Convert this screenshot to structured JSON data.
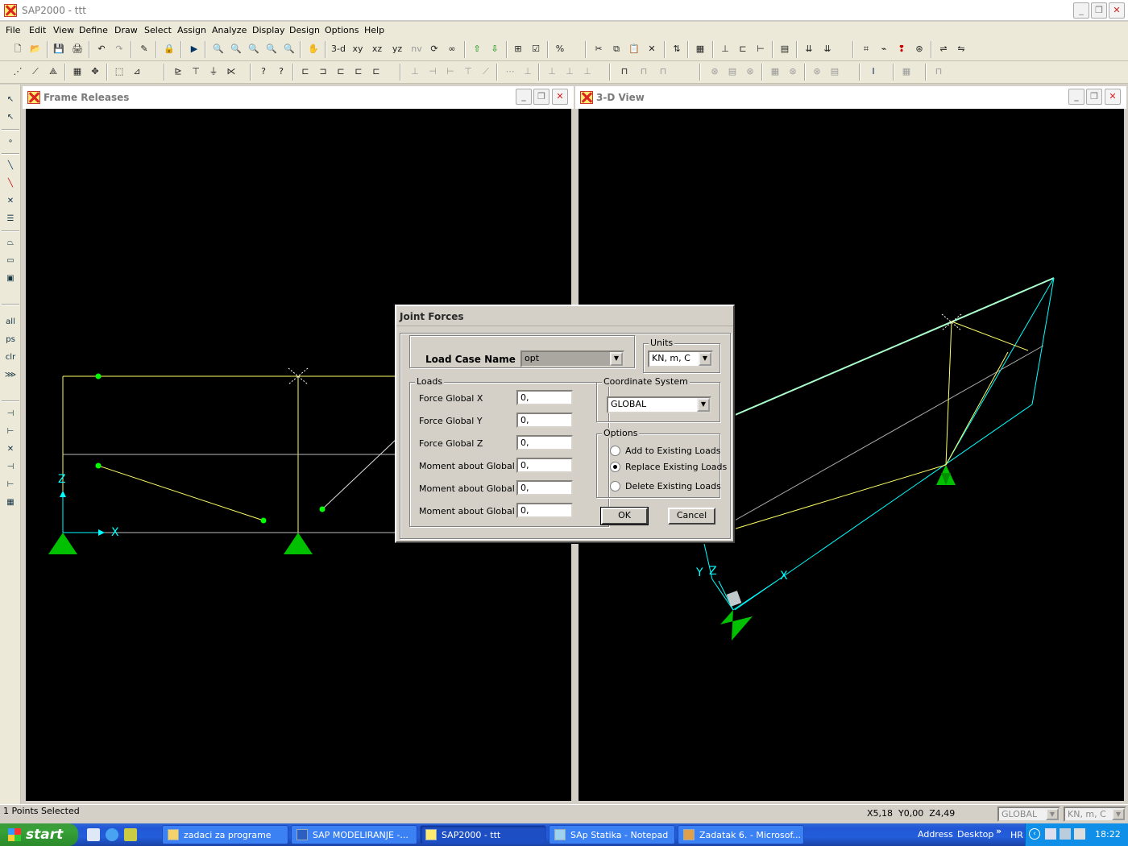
{
  "app": {
    "title": "SAP2000 - ttt"
  },
  "menu": [
    "File",
    "Edit",
    "View",
    "Define",
    "Draw",
    "Select",
    "Assign",
    "Analyze",
    "Display",
    "Design",
    "Options",
    "Help"
  ],
  "toolbar": {
    "view_3d": "3-d",
    "view_xy": "xy",
    "view_xz": "xz",
    "view_yz": "yz",
    "view_nv": "nv"
  },
  "left_toolbar": {
    "all": "all",
    "ps": "ps",
    "clr": "clr"
  },
  "windows": {
    "left": {
      "title": "Frame Releases",
      "axis_x": "X",
      "axis_z": "Z"
    },
    "right": {
      "title": "3-D View",
      "axis_x": "X",
      "axis_y": "Y",
      "axis_z": "Z"
    }
  },
  "dialog": {
    "title": "Joint Forces",
    "load_case_label": "Load Case Name",
    "load_case_value": "opt",
    "units_group": "Units",
    "units_value": "KN, m, C",
    "loads_group": "Loads",
    "loads": [
      {
        "label": "Force Global X",
        "value": "0,"
      },
      {
        "label": "Force Global Y",
        "value": "0,"
      },
      {
        "label": "Force Global Z",
        "value": "0,"
      },
      {
        "label": "Moment about Global X",
        "value": "0,"
      },
      {
        "label": "Moment about Global Y",
        "value": "0,"
      },
      {
        "label": "Moment about Global Z",
        "value": "0,"
      }
    ],
    "coord_group": "Coordinate System",
    "coord_value": "GLOBAL",
    "options_group": "Options",
    "options": [
      {
        "label": "Add to Existing Loads",
        "selected": false
      },
      {
        "label": "Replace Existing Loads",
        "selected": true
      },
      {
        "label": "Delete Existing Loads",
        "selected": false
      }
    ],
    "ok": "OK",
    "cancel": "Cancel"
  },
  "status": {
    "left": "1 Points Selected",
    "coords": "X5,18  Y0,00  Z4,49",
    "coord_sys": "GLOBAL",
    "units": "KN, m, C"
  },
  "taskbar": {
    "start": "start",
    "tasks": [
      {
        "label": "zadaci za programe",
        "active": false
      },
      {
        "label": "SAP  MODELIRANJE -...",
        "active": false
      },
      {
        "label": "SAP2000 - ttt",
        "active": true
      },
      {
        "label": "SAp Statika - Notepad",
        "active": false
      },
      {
        "label": "Zadatak 6. - Microsof...",
        "active": false
      }
    ],
    "address": "Address",
    "desktop": "Desktop",
    "lang": "HR",
    "time": "18:22"
  },
  "colors": {
    "canvas": "#000000",
    "frame": "#ffff66",
    "support": "#00c000",
    "axis": "#00ffff",
    "joint": "#00ff00"
  }
}
